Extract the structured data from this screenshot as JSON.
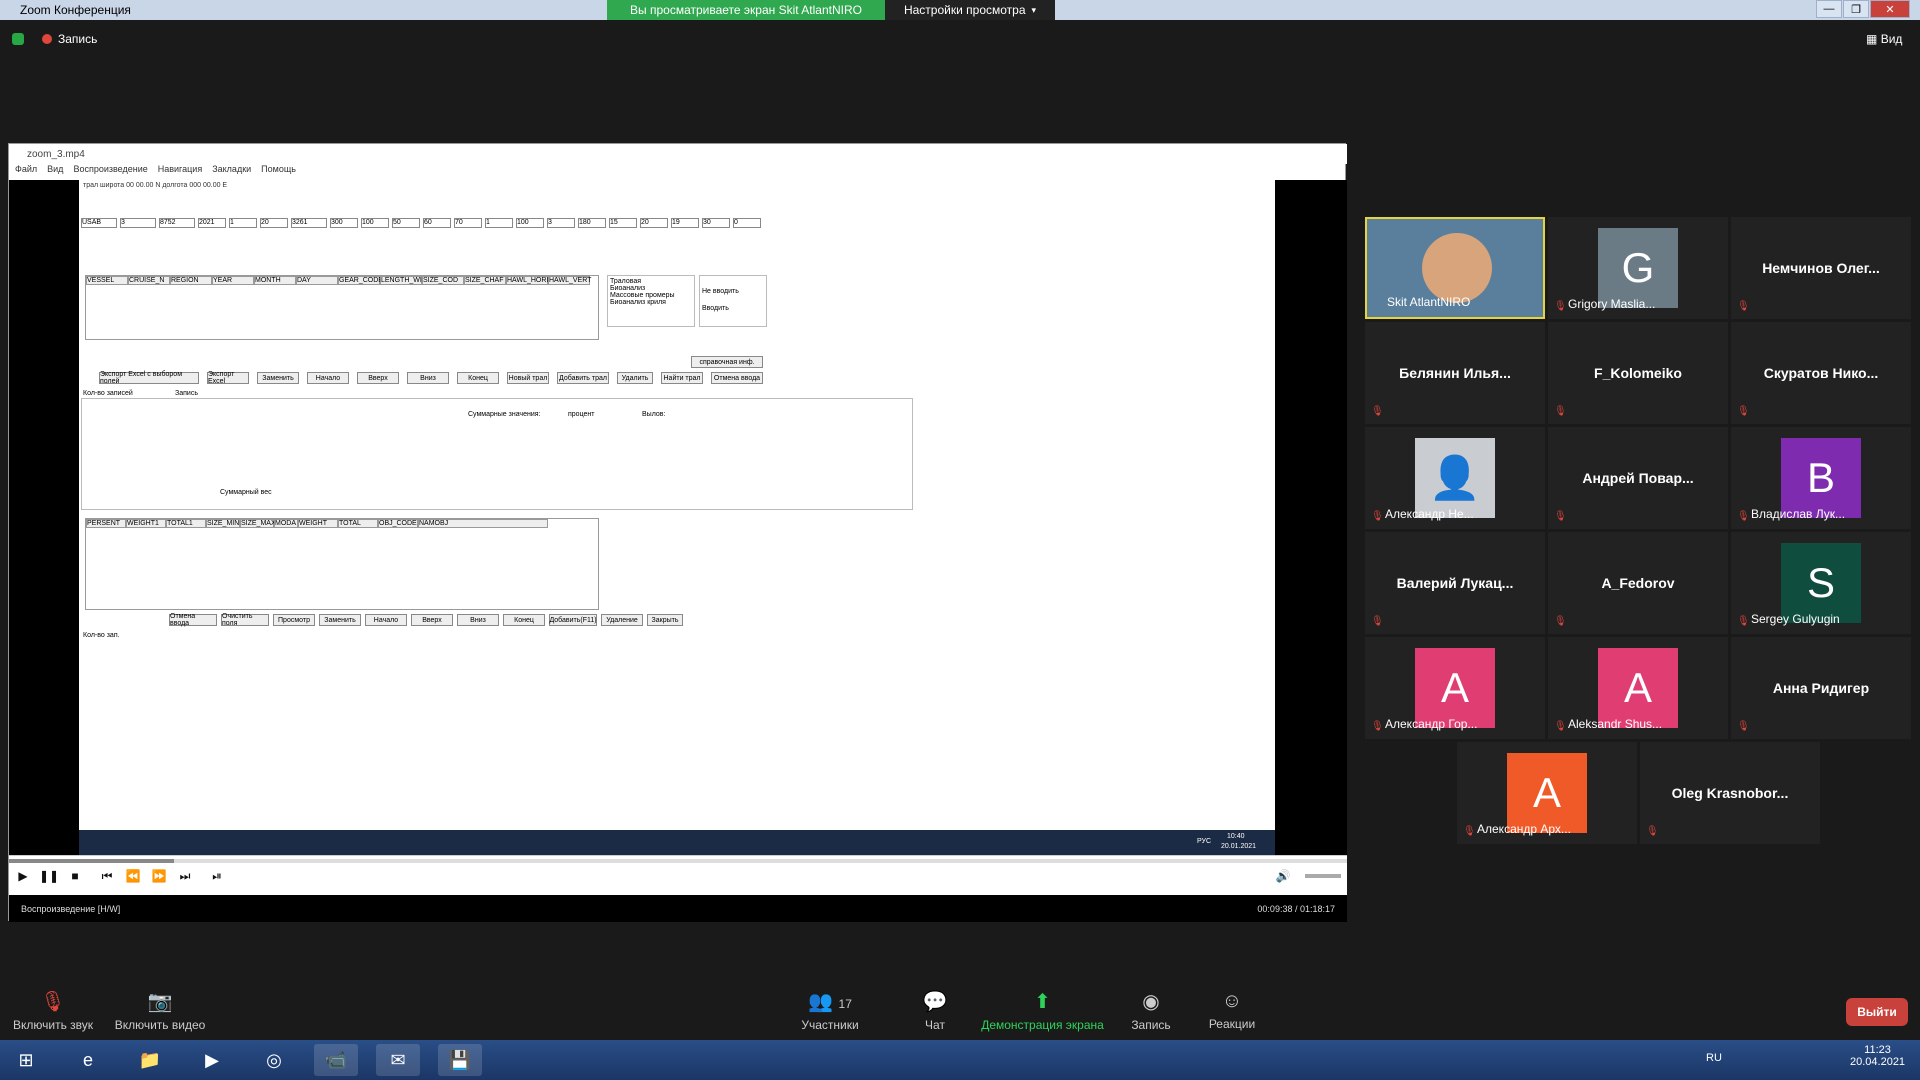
{
  "zoom": {
    "window_title": "Zoom Конференция",
    "share_banner": "Вы просматриваете экран Skit AtlantNIRO",
    "view_options": "Настройки просмотра",
    "recording": "Запись",
    "view_button": "Вид",
    "leave_button": "Выйти",
    "participants_count": "17"
  },
  "player": {
    "title": "zoom_3.mp4",
    "menu": [
      "Файл",
      "Вид",
      "Воспроизведение",
      "Навигация",
      "Закладки",
      "Помощь"
    ],
    "status_left": "Воспроизведение [H/W]",
    "status_time": "00:09:38 / 01:18:17"
  },
  "inner_app": {
    "title": "трал  широта 00 00.00  N долгота 000 00.00  E",
    "field_row1": [
      "USAB",
      "3",
      "8752",
      "2021",
      "1",
      "20",
      "3261",
      "300",
      "100",
      "50",
      "60",
      "70",
      "1",
      "100",
      "3",
      "180",
      "15",
      "20",
      "19",
      "30",
      "0"
    ],
    "table1_cols": [
      "VESSEL",
      "CRUISE_N",
      "REGION",
      "YEAR",
      "MONTH",
      "DAY",
      "GEAR_CODE",
      "LENGTH_WIR",
      "SIZE_COD",
      "SIZE_CHAF",
      "HAWL_HORIZ",
      "HAWL_VERT"
    ],
    "info_types": [
      "Траловая",
      "Биоанализ",
      "Массовые промеры",
      "Биоанализ криля"
    ],
    "second_interval": [
      "Не вводить",
      "Вводить"
    ],
    "buttons_row1": [
      "Экспорт Excel с выбором полей",
      "Экспорт Excel",
      "Заменить",
      "Начало",
      "Вверх",
      "Вниз",
      "Конец",
      "Новый трал",
      "Добавить трал",
      "Удалить",
      "Найти трал",
      "Отмена ввода"
    ],
    "reference_button": "справочная инф.",
    "records_label": "Кол-во записей",
    "record_label": "Запись",
    "sum_label": "Суммарные значения:",
    "percent_label": "процент",
    "catch_label": "Вылов:",
    "sum_weight_label": "Суммарный вес",
    "table2_cols": [
      "PERSENT",
      "WEIGHT1",
      "TOTAL1",
      "SIZE_MIN",
      "SIZE_MAX",
      "MODA",
      "WEIGHT",
      "TOTAL",
      "OBJ_CODE",
      "NAMOBJ"
    ],
    "buttons_row2": [
      "Отмена ввода",
      "Очистить поля",
      "Просмотр",
      "Заменить",
      "Начало",
      "Вверх",
      "Вниз",
      "Конец",
      "Добавить(F11)",
      "Удаление",
      "Закрыть"
    ],
    "records_label2": "Кол-во зап.",
    "taskbar_lang": "РУС",
    "taskbar_time": "10:40",
    "taskbar_date": "20.01.2021"
  },
  "participants": [
    {
      "name": "Skit AtlantNIRO",
      "type": "video"
    },
    {
      "name": "Grigory Maslia...",
      "type": "avatar",
      "letter": "G",
      "color": "#6b7b86"
    },
    {
      "name": "Немчинов Олег...",
      "type": "name"
    },
    {
      "name": "Белянин Илья...",
      "type": "name"
    },
    {
      "name": "F_Kolomeiko",
      "type": "name"
    },
    {
      "name": "Скуратов Нико...",
      "type": "name"
    },
    {
      "name": "Александр Не...",
      "type": "avatar",
      "letter": "",
      "color": "#c9ccd0"
    },
    {
      "name": "Андрей Повар...",
      "type": "name"
    },
    {
      "name": "Владислав Лук...",
      "type": "avatar",
      "letter": "B",
      "color": "#7e2bb0"
    },
    {
      "name": "Валерий Лукац...",
      "type": "name"
    },
    {
      "name": "A_Fedorov",
      "type": "name"
    },
    {
      "name": "Sergey Gulyugin",
      "type": "avatar",
      "letter": "S",
      "color": "#0f4d3e"
    },
    {
      "name": "Александр Гор...",
      "type": "avatar",
      "letter": "A",
      "color": "#e03e73"
    },
    {
      "name": "Aleksandr Shus...",
      "type": "avatar",
      "letter": "A",
      "color": "#e03e73"
    },
    {
      "name": "Анна Ридигер",
      "type": "name"
    },
    {
      "name": "Александр Арх...",
      "type": "avatar",
      "letter": "A",
      "color": "#f05a28"
    },
    {
      "name": "Oleg Krasnobor...",
      "type": "name"
    }
  ],
  "toolbar": {
    "unmute": "Включить звук",
    "start_video": "Включить видео",
    "participants": "Участники",
    "chat": "Чат",
    "share": "Демонстрация экрана",
    "record": "Запись",
    "reactions": "Реакции"
  },
  "taskbar": {
    "lang": "RU",
    "time": "11:23",
    "date": "20.04.2021"
  }
}
